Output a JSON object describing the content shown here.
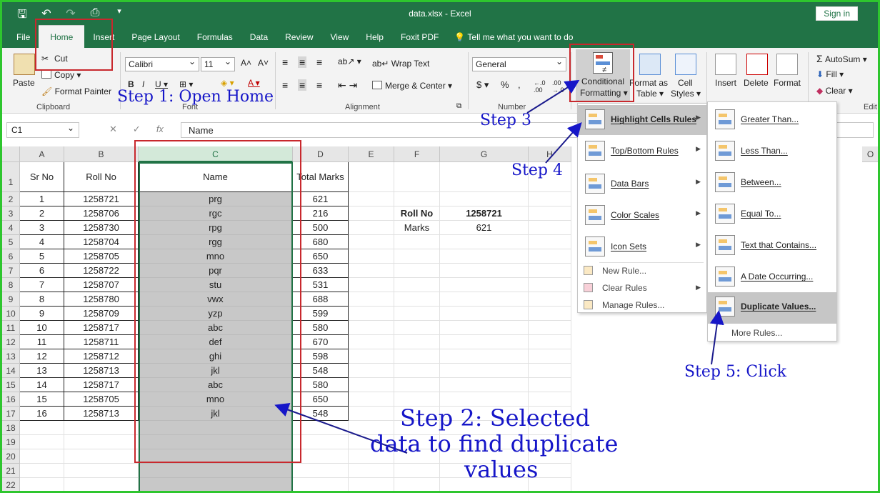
{
  "window": {
    "file_title": "data.xlsx",
    "app_name": "Excel",
    "sign_in": "Sign in"
  },
  "tabs": [
    "File",
    "Home",
    "Insert",
    "Page Layout",
    "Formulas",
    "Data",
    "Review",
    "View",
    "Help",
    "Foxit PDF"
  ],
  "tell_me": "Tell me what you want to do",
  "ribbon": {
    "clipboard": {
      "paste": "Paste",
      "cut": "Cut",
      "copy": "Copy",
      "format_painter": "Format Painter",
      "label": "Clipboard"
    },
    "font": {
      "name": "Calibri",
      "size": "11",
      "label": "Font"
    },
    "alignment": {
      "wrap_text": "Wrap Text",
      "merge_center": "Merge & Center",
      "label": "Alignment"
    },
    "number": {
      "format": "General",
      "label": "Number"
    },
    "styles": {
      "conditional": "Conditional",
      "formatting": "Formatting",
      "format_as": "Format as",
      "table": "Table",
      "cell": "Cell",
      "styles": "Styles"
    },
    "cells": {
      "insert": "Insert",
      "delete": "Delete",
      "format": "Format"
    },
    "editing": {
      "autosum": "AutoSum",
      "fill": "Fill",
      "clear": "Clear",
      "label": "Edit"
    }
  },
  "formula_bar": {
    "name_box": "C1",
    "value": "Name"
  },
  "columns": [
    "A",
    "B",
    "C",
    "D",
    "E",
    "F",
    "G",
    "H",
    "O"
  ],
  "headers": {
    "a": "Sr No",
    "b": "Roll No",
    "c": "Name",
    "d": "Total Marks"
  },
  "rows": [
    [
      "1",
      "1258721",
      "prg",
      "621"
    ],
    [
      "2",
      "1258706",
      "rgc",
      "216"
    ],
    [
      "3",
      "1258730",
      "rpg",
      "500"
    ],
    [
      "4",
      "1258704",
      "rgg",
      "680"
    ],
    [
      "5",
      "1258705",
      "mno",
      "650"
    ],
    [
      "6",
      "1258722",
      "pqr",
      "633"
    ],
    [
      "7",
      "1258707",
      "stu",
      "531"
    ],
    [
      "8",
      "1258780",
      "vwx",
      "688"
    ],
    [
      "9",
      "1258709",
      "yzp",
      "599"
    ],
    [
      "10",
      "1258717",
      "abc",
      "580"
    ],
    [
      "11",
      "1258711",
      "def",
      "670"
    ],
    [
      "12",
      "1258712",
      "ghi",
      "598"
    ],
    [
      "13",
      "1258713",
      "jkl",
      "548"
    ],
    [
      "14",
      "1258717",
      "abc",
      "580"
    ],
    [
      "15",
      "1258705",
      "mno",
      "650"
    ],
    [
      "16",
      "1258713",
      "jkl",
      "548"
    ]
  ],
  "row_numbers": [
    "1",
    "2",
    "3",
    "4",
    "5",
    "6",
    "7",
    "8",
    "9",
    "10",
    "11",
    "12",
    "13",
    "14",
    "15",
    "16",
    "17",
    "18",
    "19",
    "20",
    "21",
    "22"
  ],
  "lookup": {
    "roll_label": "Roll No",
    "roll_value": "1258721",
    "marks_label": "Marks",
    "marks_value": "621"
  },
  "menu_main": {
    "items": [
      "Highlight Cells Rules",
      "Top/Bottom Rules",
      "Data Bars",
      "Color Scales",
      "Icon Sets"
    ],
    "small": [
      "New Rule...",
      "Clear Rules",
      "Manage Rules..."
    ]
  },
  "menu_sub": {
    "items": [
      "Greater Than...",
      "Less Than...",
      "Between...",
      "Equal To...",
      "Text that Contains...",
      "A Date Occurring...",
      "Duplicate Values..."
    ],
    "more": "More Rules..."
  },
  "steps": {
    "s1": "Step 1: Open Home",
    "s2a": "Step 2: Selected",
    "s2b": "data to find duplicate",
    "s2c": "values",
    "s3": "Step 3",
    "s4": "Step 4",
    "s5": "Step 5: Click"
  },
  "colors": {
    "excel_green": "#217346",
    "annotation_blue": "#1616c8",
    "highlight_red": "#c8282d",
    "frame_green": "#2ec62e"
  }
}
